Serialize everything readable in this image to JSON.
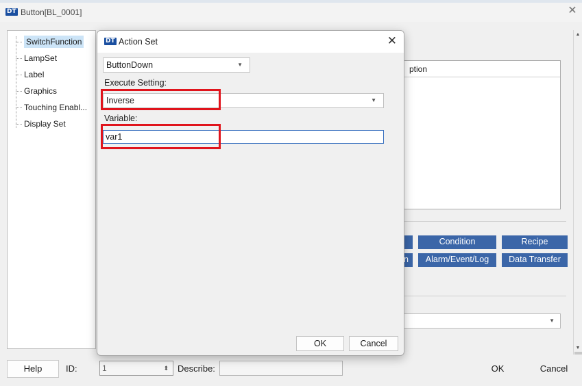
{
  "outer_window": {
    "title": "Button[BL_0001]",
    "logo_text": "DT"
  },
  "tree": {
    "items": [
      {
        "label": "SwitchFunction",
        "selected": true
      },
      {
        "label": "LampSet"
      },
      {
        "label": "Label"
      },
      {
        "label": "Graphics"
      },
      {
        "label": "Touching Enabl..."
      },
      {
        "label": "Display Set"
      }
    ]
  },
  "grid": {
    "partial_header": "ption"
  },
  "action_buttons": {
    "row1": [
      "Condition",
      "Recipe"
    ],
    "row2": [
      "n",
      "Alarm/Event/Log",
      "Data Transfer"
    ]
  },
  "bottom_bar": {
    "help_label": "Help",
    "id_label": "ID:",
    "id_value": "1",
    "describe_label": "Describe:",
    "describe_value": "",
    "ok_label": "OK",
    "cancel_label": "Cancel"
  },
  "action_set": {
    "title": "Action Set",
    "logo_text": "DT",
    "trigger_value": "ButtonDown",
    "execute_setting_label": "Execute Setting:",
    "execute_setting_value": "Inverse",
    "variable_label": "Variable:",
    "variable_value": "var1",
    "ok_label": "OK",
    "cancel_label": "Cancel"
  },
  "colors": {
    "accent_button": "#3b66a8",
    "highlight": "#e0141c",
    "selection": "#cce4f7"
  }
}
